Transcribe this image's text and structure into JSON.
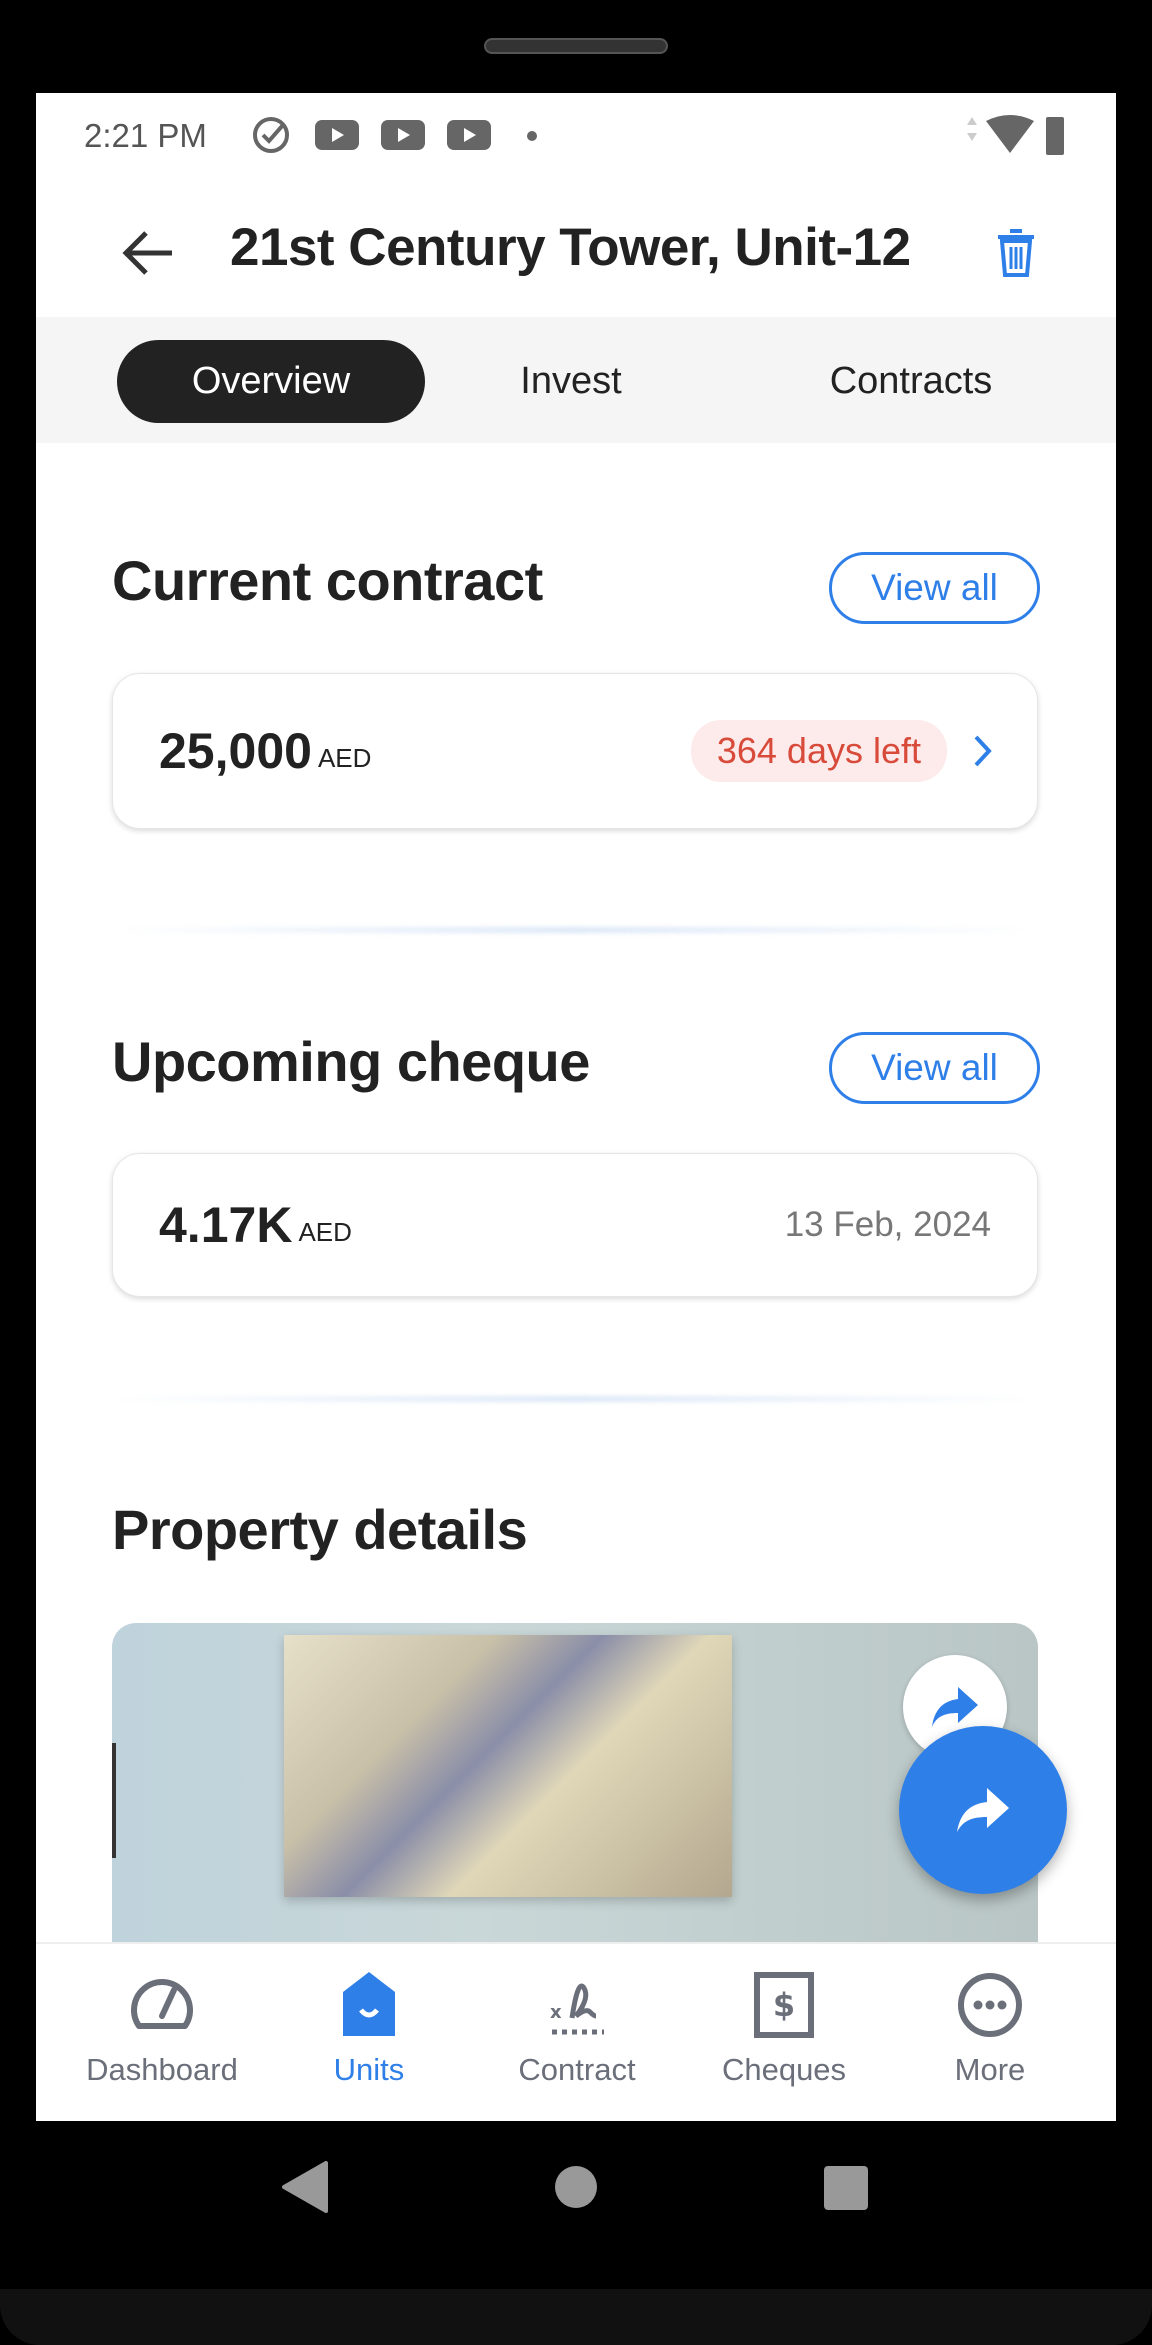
{
  "status_bar": {
    "time": "2:21 PM"
  },
  "header": {
    "title": "21st Century Tower, Unit-12",
    "back_icon": "arrow-left-icon",
    "delete_icon": "trash-icon"
  },
  "tabs": [
    {
      "label": "Overview",
      "active": true
    },
    {
      "label": "Invest"
    },
    {
      "label": "Contracts"
    }
  ],
  "current_contract": {
    "heading": "Current contract",
    "view_all": "View all",
    "amount": "25,000",
    "currency": "AED",
    "badge": "364 days left"
  },
  "upcoming_cheque": {
    "heading": "Upcoming cheque",
    "view_all": "View all",
    "amount": "4.17K",
    "currency": "AED",
    "date": "13 Feb, 2024"
  },
  "property_details": {
    "heading": "Property details"
  },
  "bottom_nav": [
    {
      "label": "Dashboard",
      "icon": "speedometer-icon"
    },
    {
      "label": "Units",
      "icon": "home-icon",
      "active": true
    },
    {
      "label": "Contract",
      "icon": "signature-icon"
    },
    {
      "label": "Cheques",
      "icon": "dollar-cheque-icon"
    },
    {
      "label": "More",
      "icon": "more-icon"
    }
  ],
  "colors": {
    "accent": "#2f7fe8",
    "badge_text": "#d84a3a",
    "badge_bg": "#fdeaea",
    "active_tab": "#222222"
  }
}
